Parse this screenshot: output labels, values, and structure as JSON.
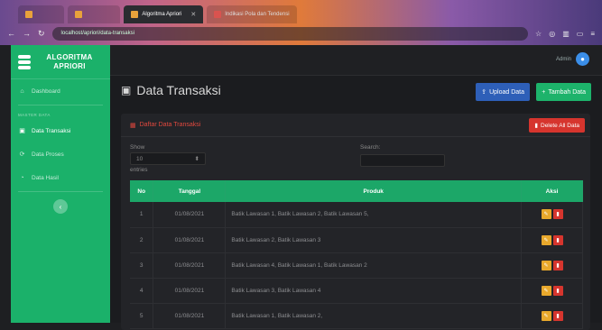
{
  "browser": {
    "tabs": [
      {
        "label": "Algoritma Apriori",
        "active": true
      },
      {
        "label": "Indikasi Pola dan Tendensi"
      }
    ],
    "url": "localhost/apriori/data-transaksi"
  },
  "sidebar": {
    "brand_line1": "ALGORITMA",
    "brand_line2": "APRIORI",
    "dashboard": "Dashboard",
    "section_heading": "MASTER DATA",
    "items": [
      {
        "label": "Data Transaksi",
        "icon": "money-icon"
      },
      {
        "label": "Data Proses",
        "icon": "sync-icon"
      },
      {
        "label": "Data Hasil",
        "icon": "chart-icon"
      }
    ],
    "collapse_icon": "chevron-left-icon"
  },
  "topbar": {
    "user": "Admin"
  },
  "page": {
    "title": "Data Transaksi",
    "upload_label": "Upload Data",
    "add_label": "Tambah Data"
  },
  "card": {
    "title": "Daftar Data Transaksi",
    "delete_all_label": "Delete All Data",
    "show_label": "Show",
    "entries_value": "10",
    "entries_label": "entries",
    "search_label": "Search:"
  },
  "table": {
    "headers": [
      "No",
      "Tanggal",
      "Produk",
      "Aksi"
    ],
    "rows": [
      {
        "no": "1",
        "tanggal": "01/08/2021",
        "produk": "Batik Lawasan 1, Batik Lawasan 2, Batik Lawasan 5,"
      },
      {
        "no": "2",
        "tanggal": "01/08/2021",
        "produk": "Batik Lawasan 2, Batik Lawasan 3"
      },
      {
        "no": "3",
        "tanggal": "01/08/2021",
        "produk": "Batik Lawasan 4, Batik Lawasan 1, Batik Lawasan 2"
      },
      {
        "no": "4",
        "tanggal": "01/08/2021",
        "produk": "Batik Lawasan 3, Batik Lawasan 4"
      },
      {
        "no": "5",
        "tanggal": "01/08/2021",
        "produk": "Batik Lawasan 1, Batik Lawasan 2,"
      }
    ]
  },
  "colors": {
    "sidebar": "#1bb16a",
    "table_header": "#1ca768",
    "upload": "#2e5fb8",
    "delete": "#d6352e",
    "edit": "#e8a82c"
  }
}
